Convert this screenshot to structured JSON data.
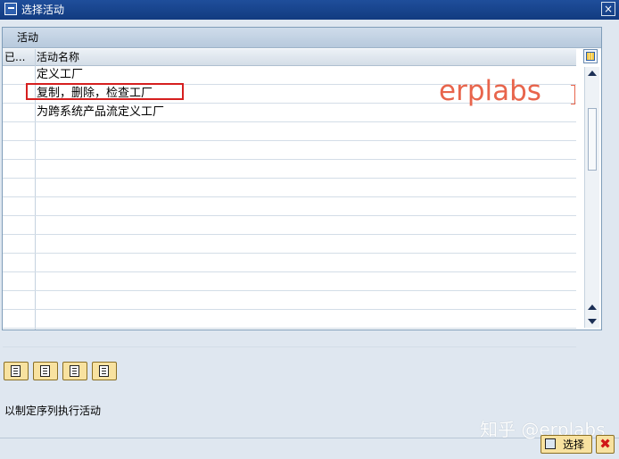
{
  "window": {
    "title": "选择活动",
    "close_label": "×"
  },
  "panel": {
    "header": "活动",
    "columns": [
      "已...",
      "活动名称"
    ],
    "rows": [
      {
        "name": "定义工厂"
      },
      {
        "name": "复制，删除，检查工厂"
      },
      {
        "name": "为跨系统产品流定义工厂"
      },
      {
        "name": ""
      },
      {
        "name": ""
      },
      {
        "name": ""
      },
      {
        "name": ""
      },
      {
        "name": ""
      },
      {
        "name": ""
      },
      {
        "name": ""
      },
      {
        "name": ""
      },
      {
        "name": ""
      },
      {
        "name": ""
      },
      {
        "name": ""
      },
      {
        "name": ""
      }
    ]
  },
  "watermark": "erplabs",
  "status_text": "以制定序列执行活动",
  "buttons": {
    "select": "选择",
    "cancel": "✖"
  },
  "site_watermark": "知乎 @erplabs",
  "colors": {
    "highlight": "#d61f1f",
    "watermark": "#e8654c",
    "title_bar": "#1f4e9b"
  }
}
